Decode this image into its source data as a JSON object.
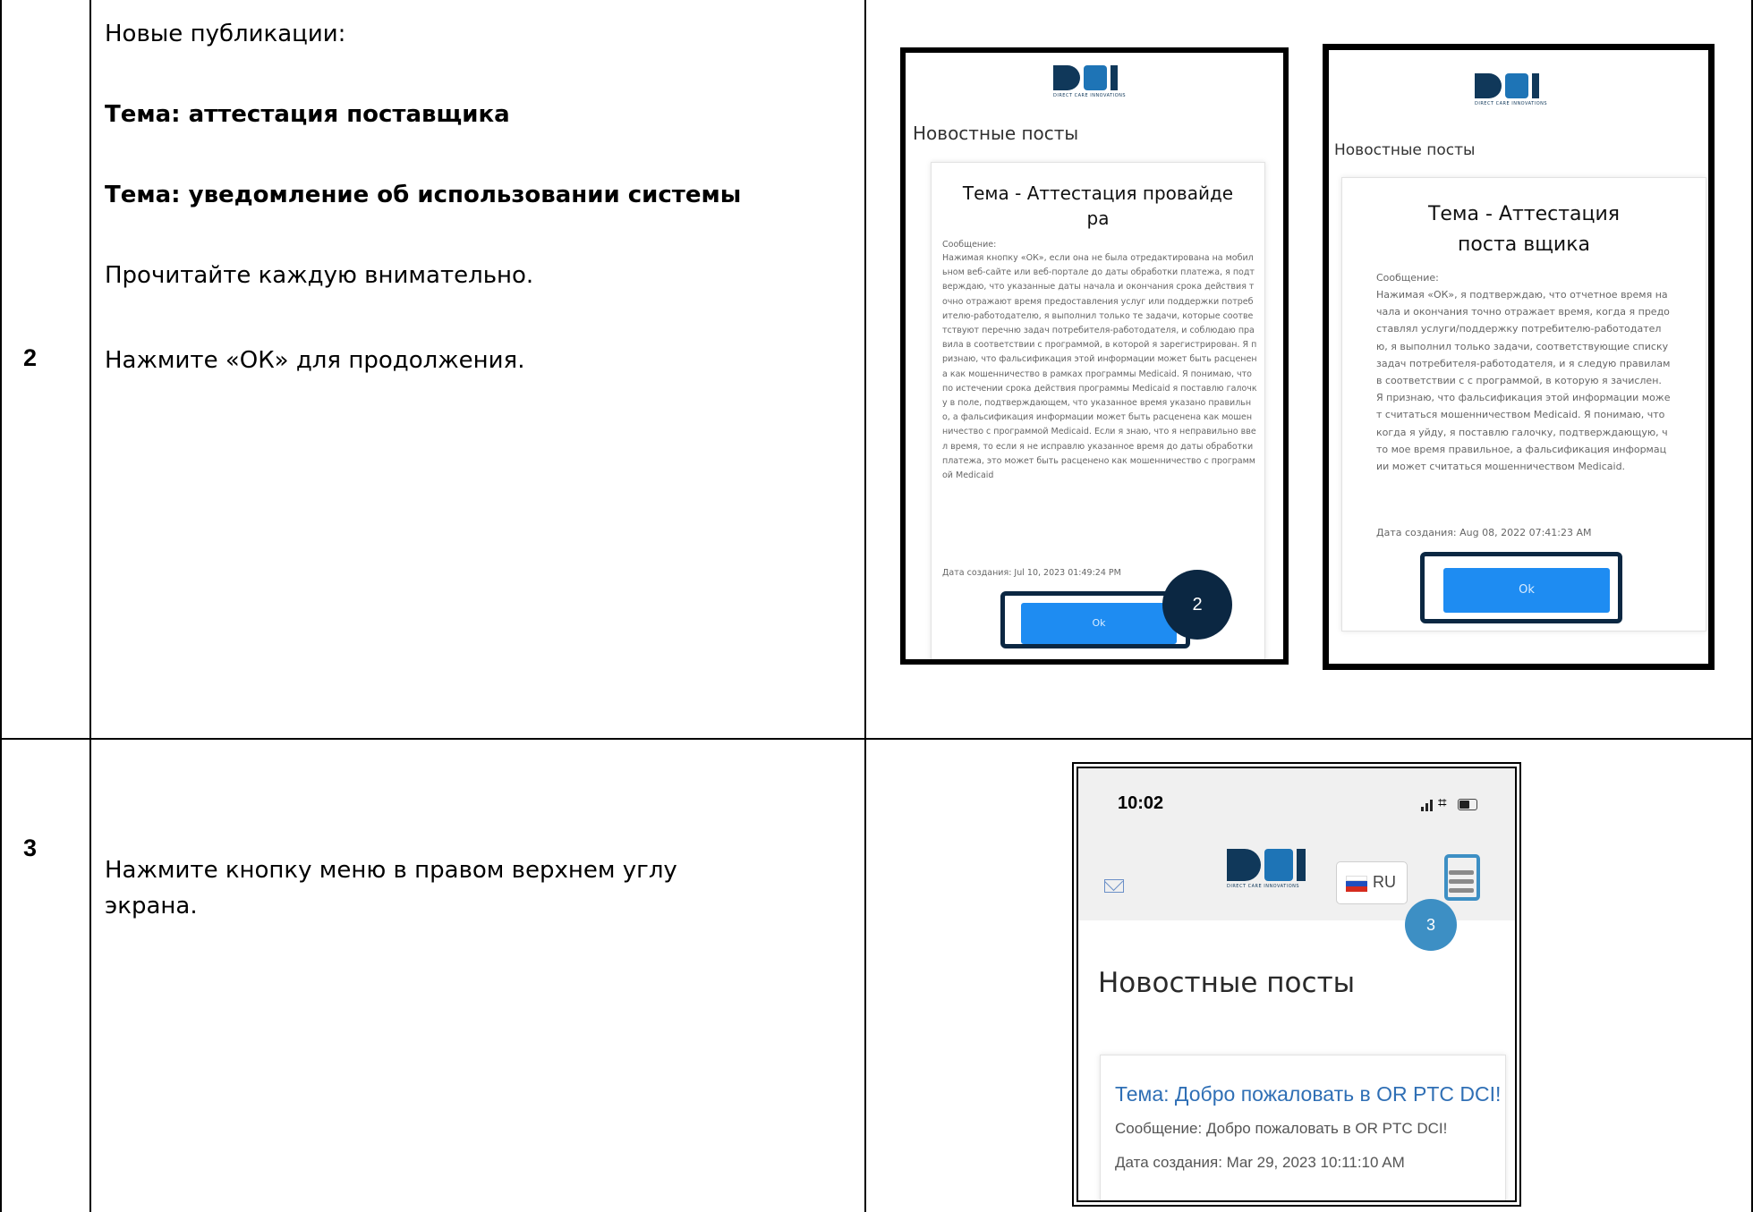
{
  "rows": [
    {
      "step": "2",
      "intro": "Новые публикации:",
      "topic1": "Тема: аттестация поставщика",
      "topic2": "Тема: уведомление об использовании системы",
      "read": "Прочитайте каждую внимательно.",
      "press": "Нажмите «ОК» для продолжения."
    },
    {
      "step": "3",
      "instruction_line1": "Нажмите кнопку меню в правом верхнем углу",
      "instruction_line2": "экрана."
    }
  ],
  "shot_a": {
    "logo_tagline": "DIRECT CARE INNOVATIONS",
    "news_title": "Новостные посты",
    "card_title": "Тема - Аттестация провайде ра",
    "message_label": "Сообщение:",
    "message_body": "Нажимая кнопку «ОК», если она не была отредактирована на мобильном веб-сайте или веб-портале до даты обработки платежа, я подтверждаю, что указанные даты начала и окончания срока действия точно отражают время предоставления услуг или поддержки потребителю-работодателю, я выполнил только те задачи, которые соответствуют перечню задач потребителя-работодателя, и соблюдаю правила в соответствии с программой, в которой я зарегистрирован. Я признаю, что фальсификация этой информации может быть расценена как мошенничество в рамках программы Medicaid. Я понимаю, что по истечении срока действия программы Medicaid я поставлю галочку в поле, подтверждающем, что указанное время указано правильно, а фальсификация информации может быть расценена как мошенничество с программой Medicaid. Если я знаю, что я неправильно ввел время, то если я не исправлю указанное время до даты обработки платежа, это может быть расценено как мошенничество с программой Medicaid",
    "date_created": "Дата создания: Jul 10, 2023 01:49:24 PM",
    "ok_label": "Ok",
    "badge": "2"
  },
  "shot_b": {
    "logo_tagline": "DIRECT CARE INNOVATIONS",
    "news_title": "Новостные посты",
    "card_title": "Тема - Аттестация поста вщика",
    "message_label": "Сообщение:",
    "message_body": "Нажимая «ОК», я подтверждаю, что отчетное время начала и окончания точно отражает время, когда я предоставлял услуги/поддержку потребителю-работодателю, я выполнил только задачи, соответствующие списку задач потребителя-работодателя, и я следую правилам в соответствии с с программой, в которую я зачислен. Я признаю, что фальсификация этой информации может считаться мошенничеством Medicaid. Я понимаю, что когда я уйду, я поставлю галочку, подтверждающую, что мое время правильное, а фальсификация информации может считаться мошенничеством Medicaid.",
    "date_created": "Дата создания: Aug 08, 2022 07:41:23 AM",
    "ok_label": "Ok"
  },
  "shot_c": {
    "time": "10:02",
    "mail_icon": "envelope-icon",
    "logo_tagline": "DIRECT CARE INNOVATIONS",
    "language": "RU",
    "menu_icon": "hamburger-menu-icon",
    "badge": "3",
    "news_title": "Новостные посты",
    "post_title": "Тема: Добро пожаловать в OR PTC DCI!",
    "post_message": "Сообщение: Добро пожаловать в OR PTC DCI!",
    "post_date": "Дата создания: Mar 29, 2023 10:11:10 AM"
  },
  "colors": {
    "highlight": "#0b2742",
    "badge": "#3d8fc4",
    "ok_button": "#1e8cf2",
    "link_blue": "#2f6fb5"
  }
}
